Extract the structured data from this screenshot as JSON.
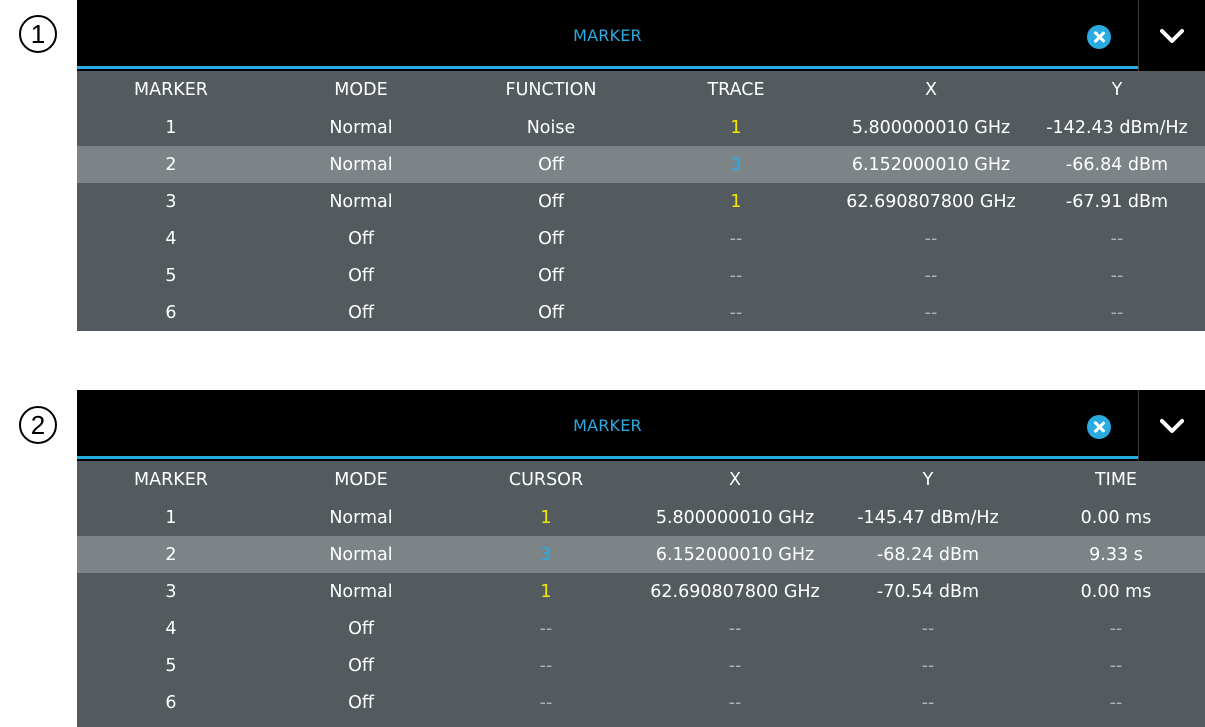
{
  "callouts": [
    "1",
    "2"
  ],
  "colors": {
    "accent": "#29abe2",
    "table_bg": "#545b5f",
    "selected_row": "#7c8488",
    "trace_yellow": "#f2e600",
    "trace_blue": "#29abe2"
  },
  "panels": [
    {
      "title": "MARKER",
      "close_icon": "close-circle-icon",
      "expand_icon": "chevron-down-icon",
      "columns": [
        "MARKER",
        "MODE",
        "FUNCTION",
        "TRACE",
        "X",
        "Y"
      ],
      "selected_row": 2,
      "rows": [
        [
          "1",
          "Normal",
          "Noise",
          "1",
          "5.800000010 GHz",
          "-142.43 dBm/Hz"
        ],
        [
          "2",
          "Normal",
          "Off",
          "3",
          "6.152000010 GHz",
          "-66.84 dBm"
        ],
        [
          "3",
          "Normal",
          "Off",
          "1",
          "62.690807800 GHz",
          "-67.91 dBm"
        ],
        [
          "4",
          "Off",
          "Off",
          "--",
          "--",
          "--"
        ],
        [
          "5",
          "Off",
          "Off",
          "--",
          "--",
          "--"
        ],
        [
          "6",
          "Off",
          "Off",
          "--",
          "--",
          "--"
        ]
      ]
    },
    {
      "title": "MARKER",
      "close_icon": "close-circle-icon",
      "expand_icon": "chevron-down-icon",
      "columns": [
        "MARKER",
        "MODE",
        "CURSOR",
        "X",
        "Y",
        "TIME"
      ],
      "selected_row": 2,
      "rows": [
        [
          "1",
          "Normal",
          "1",
          "5.800000010 GHz",
          "-145.47 dBm/Hz",
          "0.00 ms"
        ],
        [
          "2",
          "Normal",
          "3",
          "6.152000010 GHz",
          "-68.24 dBm",
          "9.33 s"
        ],
        [
          "3",
          "Normal",
          "1",
          "62.690807800 GHz",
          "-70.54 dBm",
          "0.00 ms"
        ],
        [
          "4",
          "Off",
          "--",
          "--",
          "--",
          "--"
        ],
        [
          "5",
          "Off",
          "--",
          "--",
          "--",
          "--"
        ],
        [
          "6",
          "Off",
          "--",
          "--",
          "--",
          "--"
        ]
      ]
    }
  ]
}
